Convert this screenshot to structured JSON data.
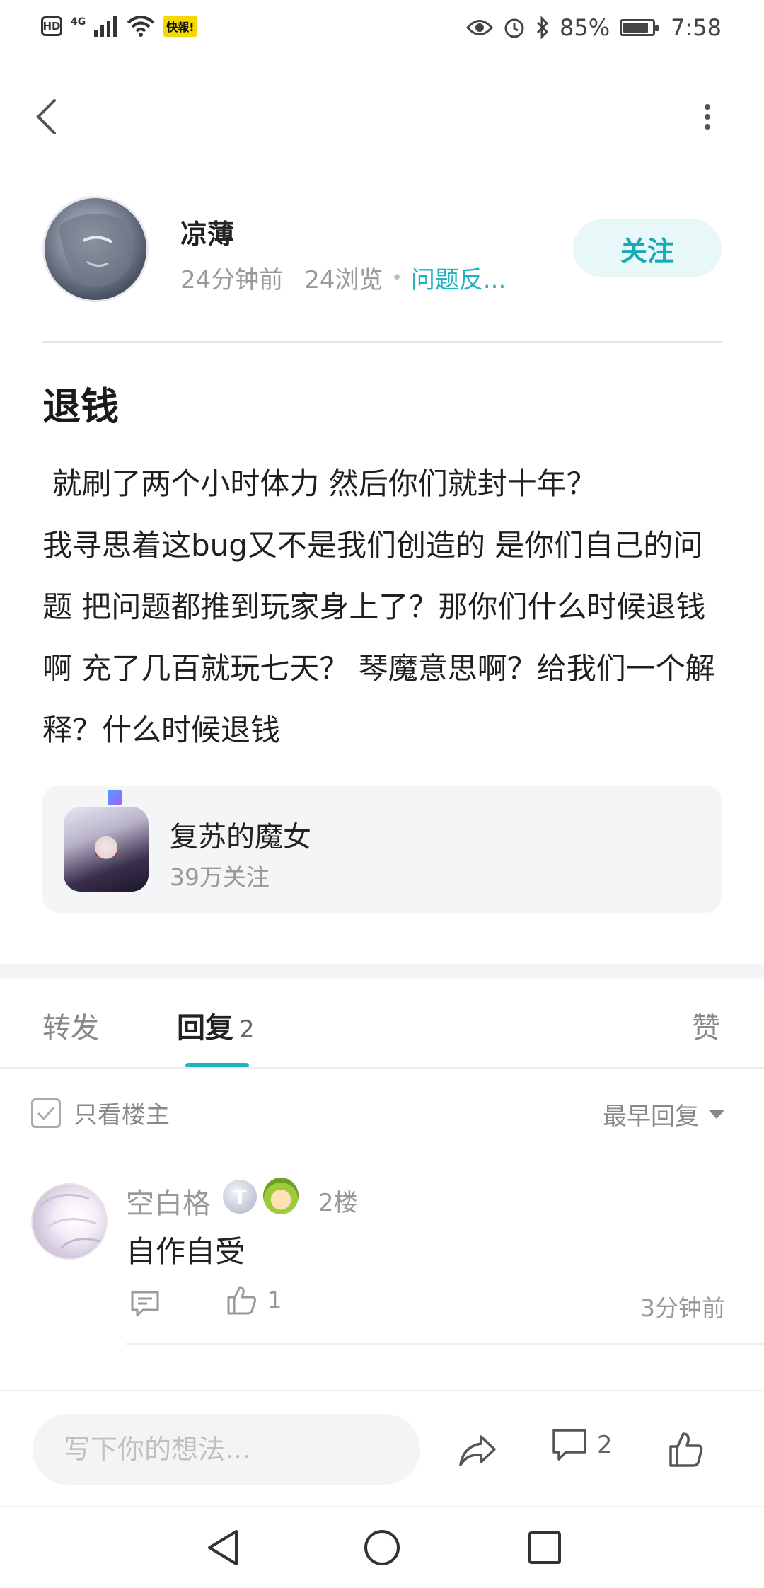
{
  "status_bar": {
    "network": "4G",
    "app_badge": "快報!",
    "battery": "85%",
    "time": "7:58",
    "hd": "HD"
  },
  "post": {
    "author": "凉薄",
    "posted_ago": "24分钟前",
    "views": "24浏览",
    "category": "问题反...",
    "follow_label": "关注",
    "title": "退钱",
    "body": " 就刷了两个小时体力 然后你们就封十年？\n我寻思着这bug又不是我们创造的 是你们自己的问题 把问题都推到玩家身上了？那你们什么时候退钱啊 充了几百就玩七天？ 琴魔意思啊？给我们一个解释？什么时候退钱"
  },
  "game_card": {
    "name": "复苏的魔女",
    "followers": "39万关注"
  },
  "tabs": {
    "repost": "转发",
    "reply": "回复",
    "reply_count": "2",
    "like": "赞",
    "active": "reply"
  },
  "filters": {
    "only_op": "只看楼主",
    "sort": "最早回复"
  },
  "replies": [
    {
      "user": "空白格",
      "level_badge": "T",
      "floor": "2楼",
      "content": "自作自受",
      "likes": "1",
      "time": "3分钟前"
    }
  ],
  "bottom_bar": {
    "input_placeholder": "写下你的想法...",
    "comment_count": "2"
  },
  "colors": {
    "accent": "#1fb3c0",
    "follow_bg": "#e8f8f9",
    "card_bg": "#f4f5f7"
  },
  "icons": [
    "back-arrow-icon",
    "more-vertical-icon",
    "checkbox-icon",
    "dropdown-caret-icon",
    "comment-icon",
    "thumbs-up-icon",
    "share-icon",
    "nav-back-icon",
    "nav-home-icon",
    "nav-recent-icon"
  ]
}
